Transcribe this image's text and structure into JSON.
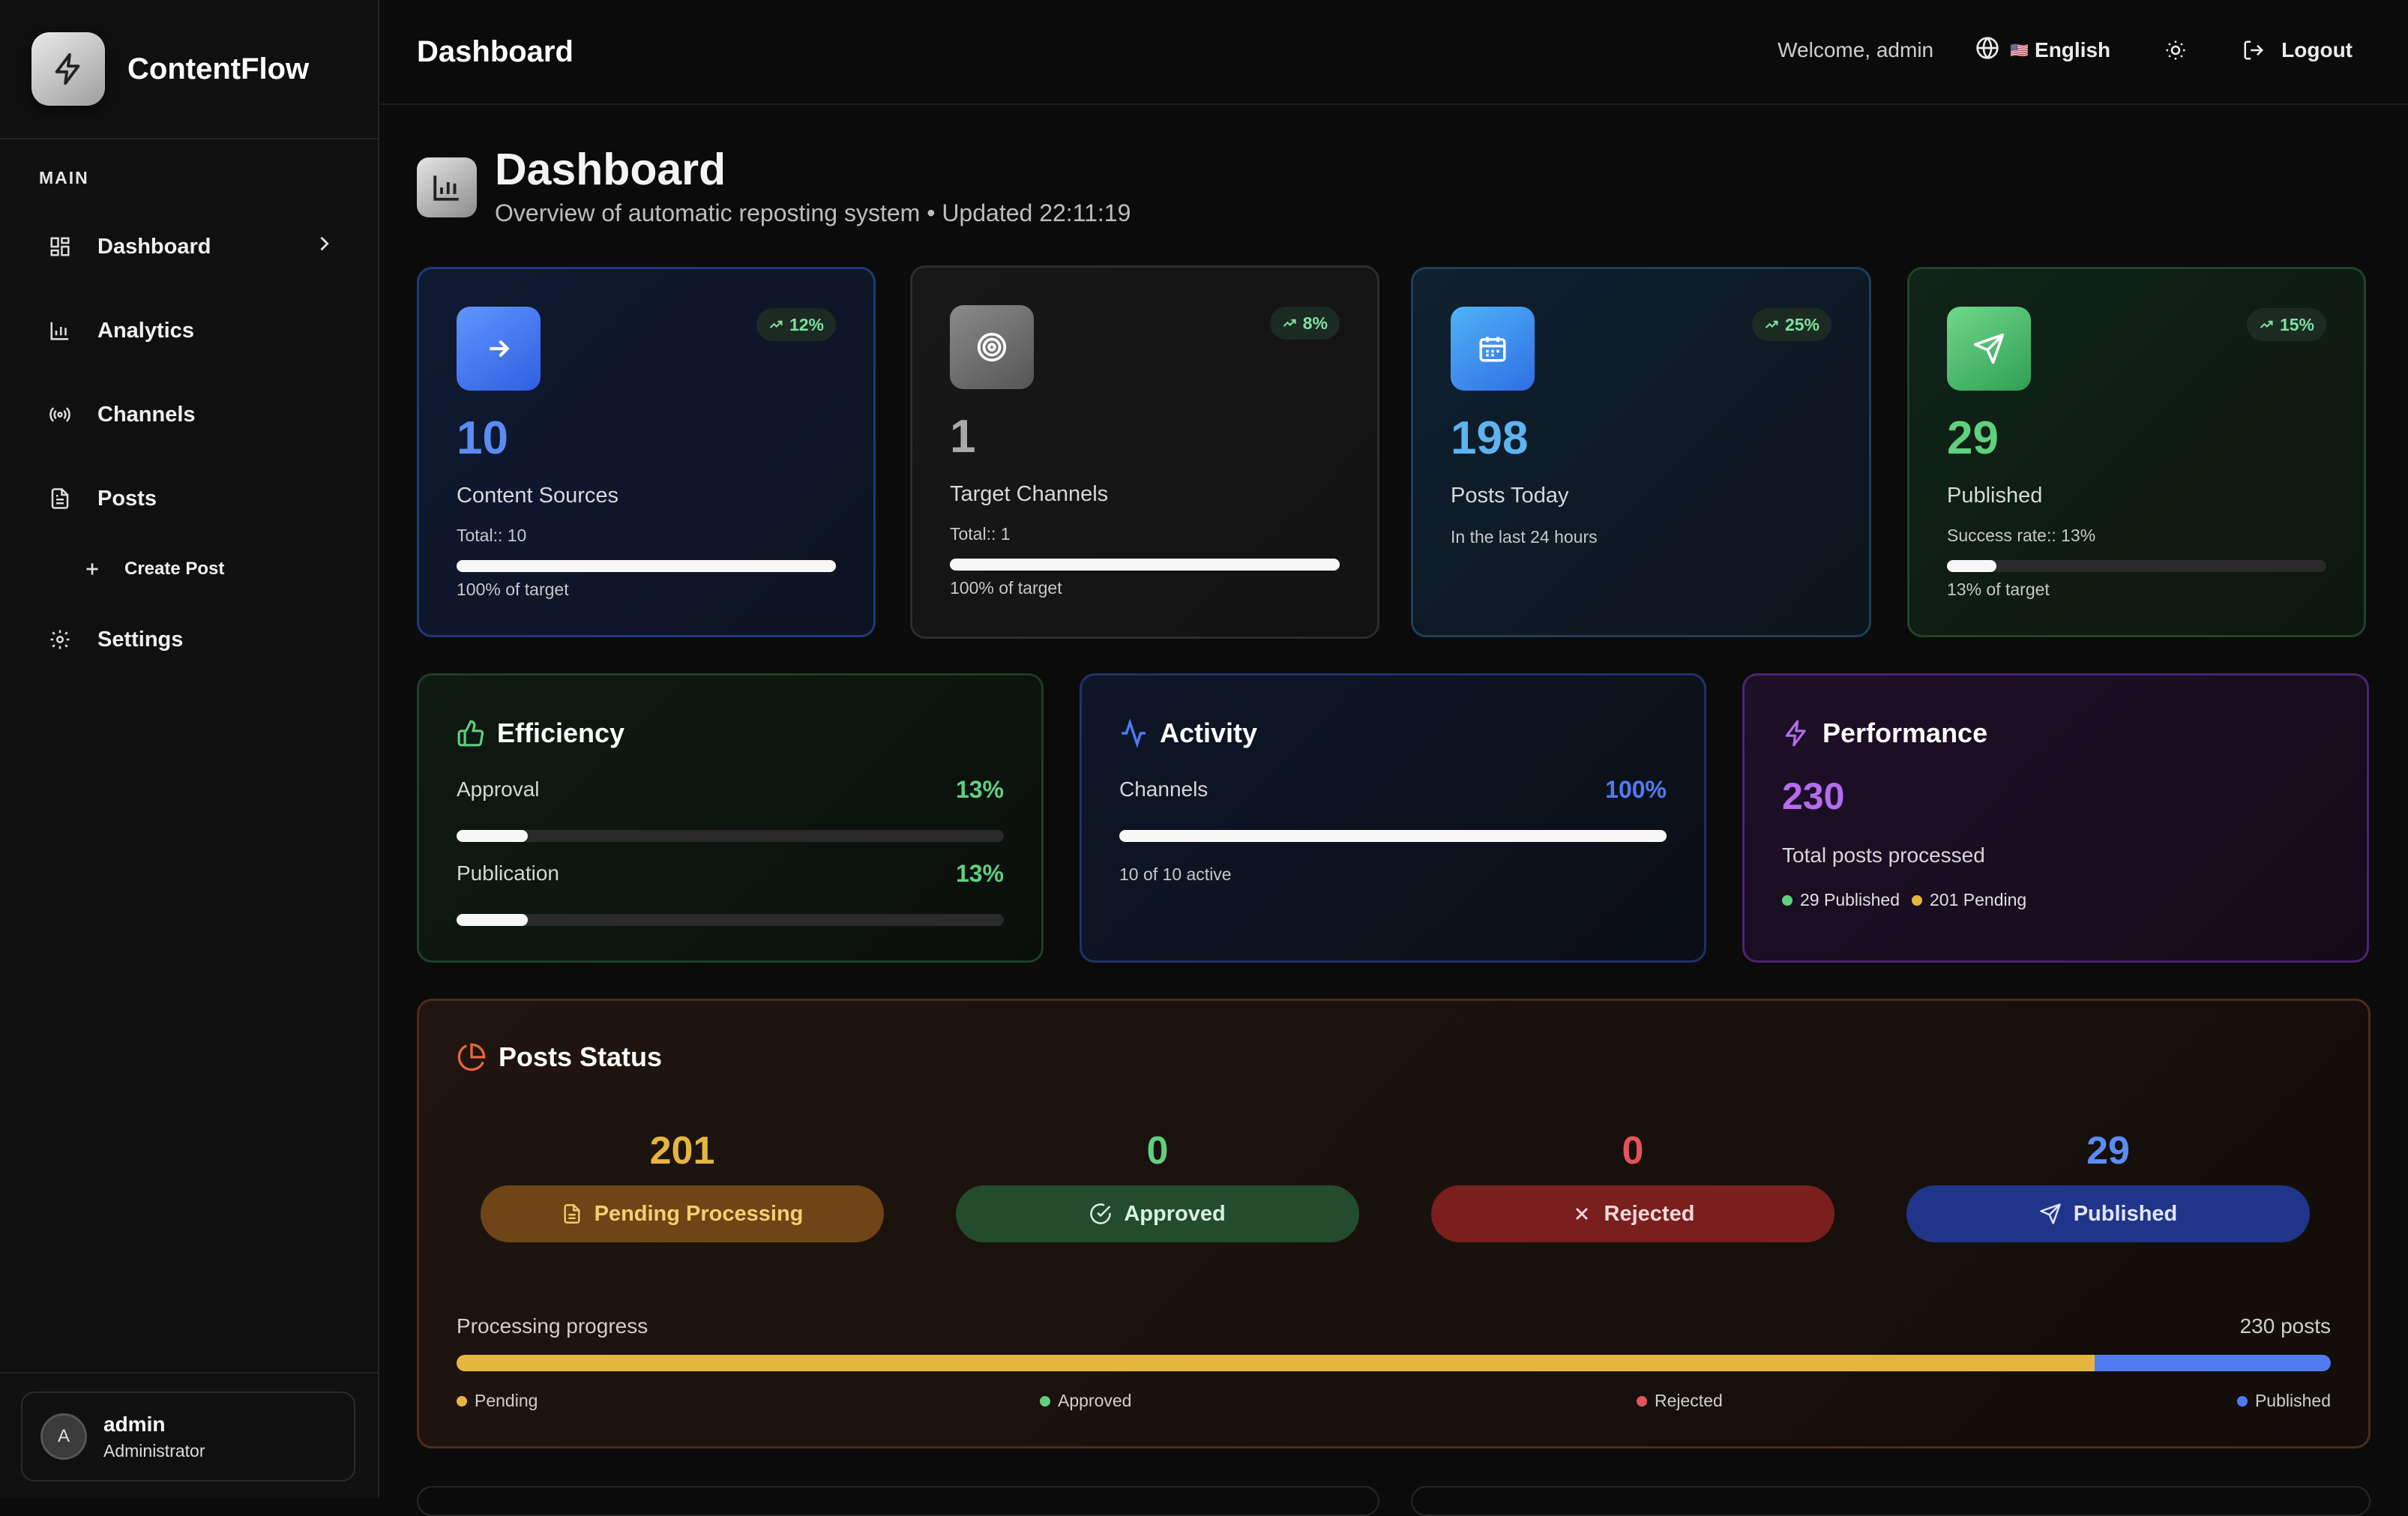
{
  "app": {
    "name": "ContentFlow"
  },
  "sidebar": {
    "section": "MAIN",
    "items": [
      {
        "label": "Dashboard"
      },
      {
        "label": "Analytics"
      },
      {
        "label": "Channels"
      },
      {
        "label": "Posts"
      },
      {
        "label": "Create Post"
      },
      {
        "label": "Settings"
      }
    ],
    "user": {
      "initial": "A",
      "name": "admin",
      "role": "Administrator"
    }
  },
  "topbar": {
    "title": "Dashboard",
    "welcome": "Welcome, admin",
    "language": "English",
    "flag": "🇺🇸",
    "logout": "Logout"
  },
  "page": {
    "title": "Dashboard",
    "subtitle": "Overview of automatic reposting system • Updated 22:11:19"
  },
  "stats": [
    {
      "trend": "12%",
      "value": "10",
      "label": "Content Sources",
      "total": "Total:: 10",
      "progress": 1.0,
      "foot": "100% of target",
      "color": "#5b8cf5"
    },
    {
      "trend": "8%",
      "value": "1",
      "label": "Target Channels",
      "total": "Total:: 1",
      "progress": 1.0,
      "foot": "100% of target",
      "color": "#a9a9a9"
    },
    {
      "trend": "25%",
      "value": "198",
      "label": "Posts Today",
      "total": "In the last 24 hours",
      "color": "#5db4f0"
    },
    {
      "trend": "15%",
      "value": "29",
      "label": "Published",
      "total": "Success rate:: 13%",
      "progress": 0.13,
      "foot": "13% of target",
      "color": "#5fd07e"
    }
  ],
  "efficiency": {
    "title": "Efficiency",
    "rows": [
      {
        "label": "Approval",
        "value": "13%",
        "progress": 0.13
      },
      {
        "label": "Publication",
        "value": "13%",
        "progress": 0.13
      }
    ]
  },
  "activity": {
    "title": "Activity",
    "label": "Channels",
    "value": "100%",
    "progress": 1.0,
    "note": "10 of 10 active"
  },
  "performance": {
    "title": "Performance",
    "value": "230",
    "label": "Total posts processed",
    "published": "29 Published",
    "pending": "201 Pending"
  },
  "posts_status": {
    "title": "Posts Status",
    "items": [
      {
        "count": "201",
        "label": "Pending Processing"
      },
      {
        "count": "0",
        "label": "Approved"
      },
      {
        "count": "0",
        "label": "Rejected"
      },
      {
        "count": "29",
        "label": "Published"
      }
    ],
    "progress_label": "Processing progress",
    "progress_total": "230 posts",
    "progress": {
      "pending": 201,
      "approved": 0,
      "rejected": 0,
      "published": 29
    },
    "legend": [
      "Pending",
      "Approved",
      "Rejected",
      "Published"
    ]
  },
  "colors": {
    "pending": "#e6b53d",
    "approved": "#5fd07e",
    "rejected": "#e5545a",
    "published": "#4f7bf0"
  }
}
